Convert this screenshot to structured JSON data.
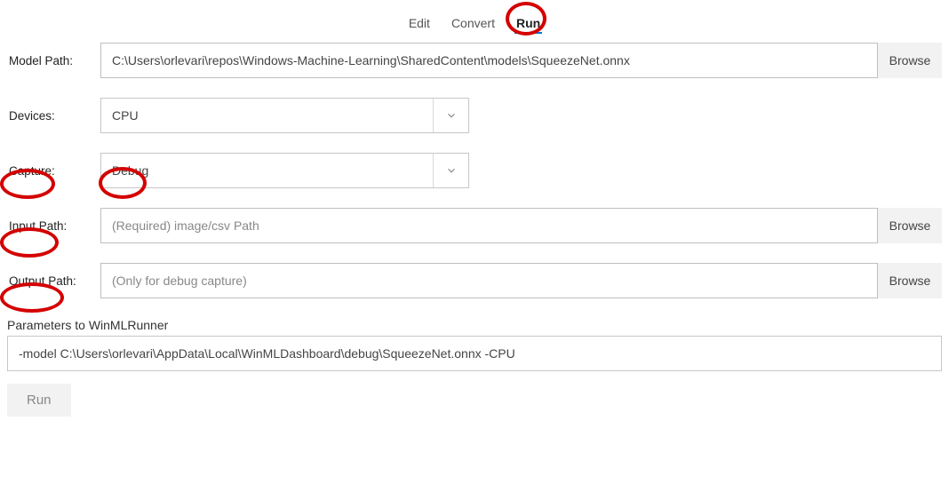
{
  "tabs": {
    "edit": "Edit",
    "convert": "Convert",
    "run": "Run"
  },
  "labels": {
    "model_path": "Model Path:",
    "devices": "Devices:",
    "capture": "Capture:",
    "input_path": "Input Path:",
    "output_path": "Output Path:",
    "parameters": "Parameters to WinMLRunner"
  },
  "values": {
    "model_path": "C:\\Users\\orlevari\\repos\\Windows-Machine-Learning\\SharedContent\\models\\SqueezeNet.onnx",
    "devices": "CPU",
    "capture": "Debug",
    "input_path": "",
    "output_path": "",
    "parameters": "-model C:\\Users\\orlevari\\AppData\\Local\\WinMLDashboard\\debug\\SqueezeNet.onnx -CPU"
  },
  "placeholders": {
    "input_path": "(Required) image/csv Path",
    "output_path": "(Only for debug capture)"
  },
  "buttons": {
    "browse": "Browse",
    "run": "Run"
  }
}
